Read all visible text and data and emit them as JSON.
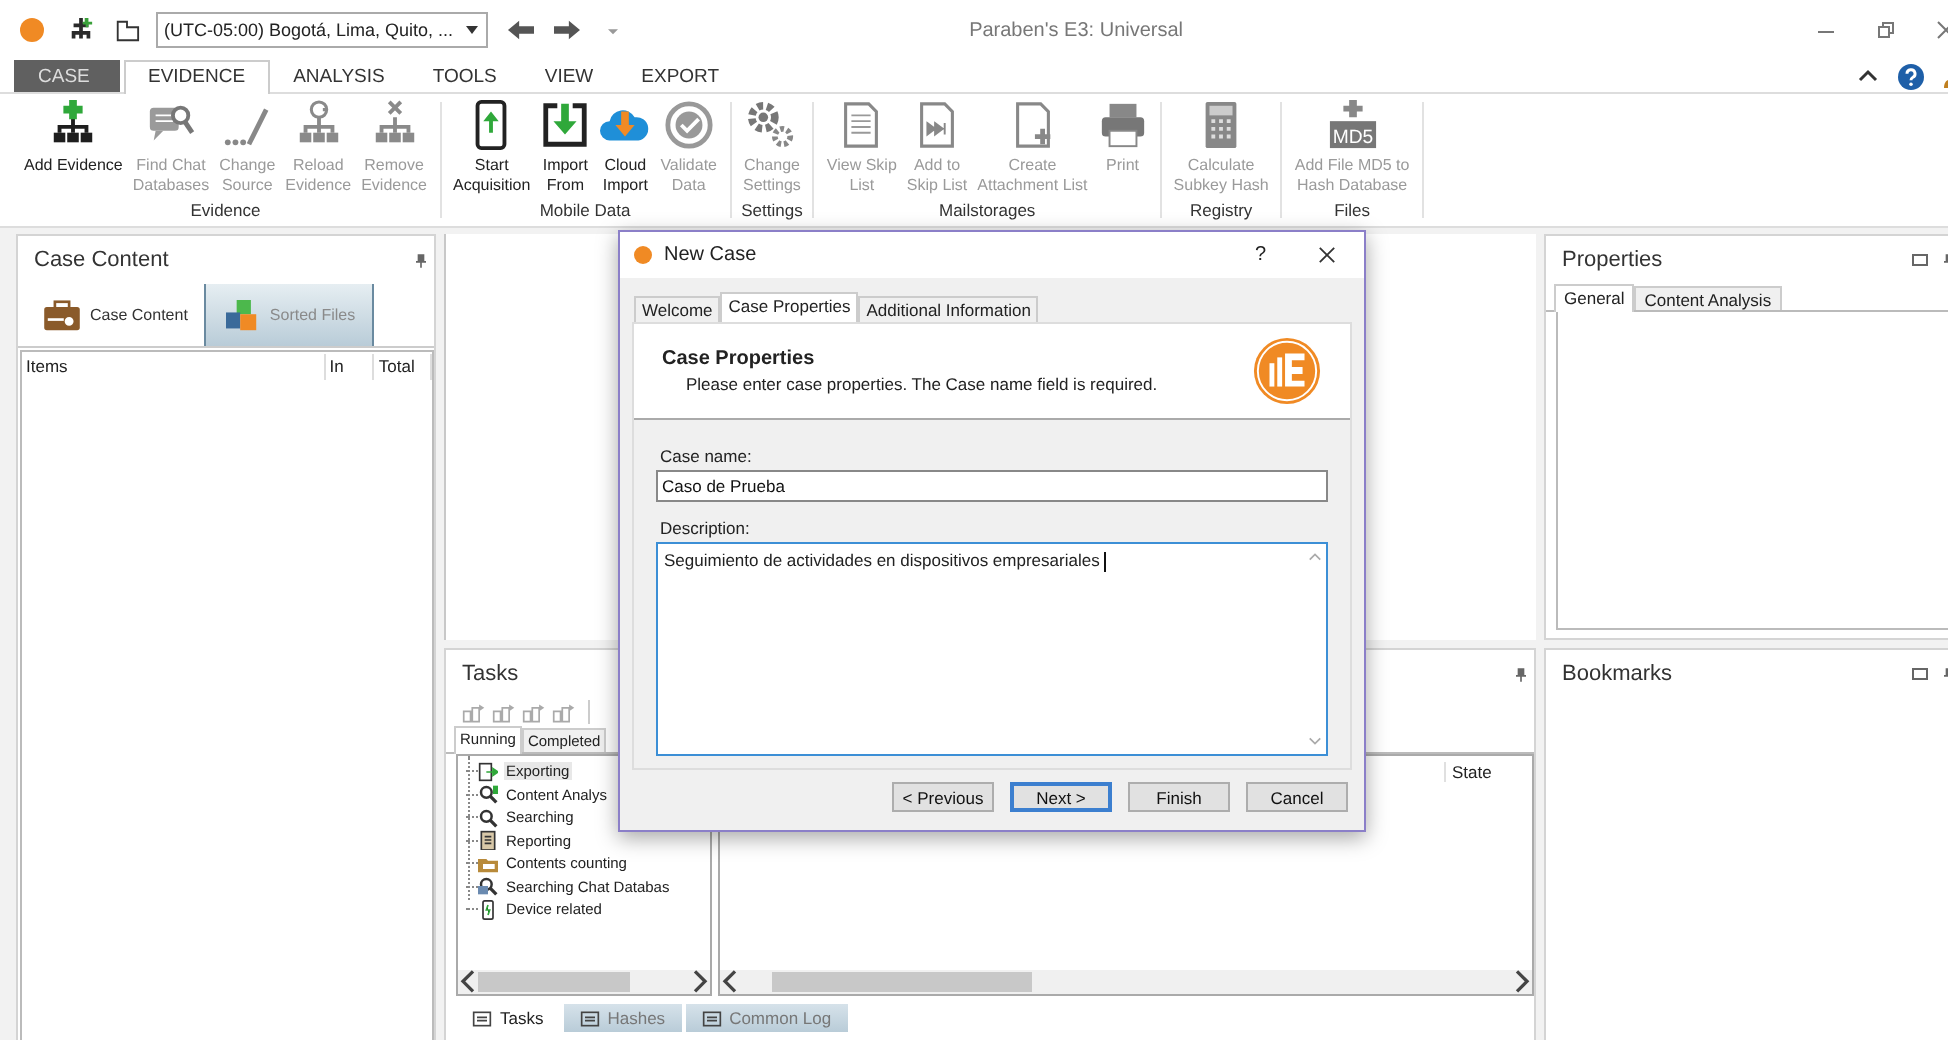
{
  "window": {
    "title": "Paraben's E3: Universal"
  },
  "quick_access": {
    "timezone": "(UTC-05:00) Bogotá, Lima, Quito, ..."
  },
  "ribbon_tabs": [
    {
      "label": "CASE",
      "kind": "menu",
      "selected": false
    },
    {
      "label": "EVIDENCE",
      "kind": "tab",
      "selected": true
    },
    {
      "label": "ANALYSIS",
      "kind": "tab",
      "selected": false
    },
    {
      "label": "TOOLS",
      "kind": "tab",
      "selected": false
    },
    {
      "label": "VIEW",
      "kind": "tab",
      "selected": false
    },
    {
      "label": "EXPORT",
      "kind": "tab",
      "selected": false
    }
  ],
  "ribbon_groups": [
    {
      "label": "Evidence",
      "buttons": [
        {
          "lines": [
            "Add Evidence"
          ],
          "disabled": false
        },
        {
          "lines": [
            "Find Chat",
            "Databases"
          ],
          "disabled": true
        },
        {
          "lines": [
            "Change",
            "Source"
          ],
          "disabled": true
        },
        {
          "lines": [
            "Reload",
            "Evidence"
          ],
          "disabled": true
        },
        {
          "lines": [
            "Remove",
            "Evidence"
          ],
          "disabled": true
        }
      ]
    },
    {
      "label": "Mobile Data",
      "buttons": [
        {
          "lines": [
            "Start",
            "Acquisition"
          ],
          "disabled": false
        },
        {
          "lines": [
            "Import",
            "From"
          ],
          "disabled": false
        },
        {
          "lines": [
            "Cloud",
            "Import"
          ],
          "disabled": false
        },
        {
          "lines": [
            "Validate",
            "Data"
          ],
          "disabled": true
        }
      ]
    },
    {
      "label": "Settings",
      "buttons": [
        {
          "lines": [
            "Change",
            "Settings"
          ],
          "disabled": true
        }
      ]
    },
    {
      "label": "Mailstorages",
      "buttons": [
        {
          "lines": [
            "View Skip",
            "List"
          ],
          "disabled": true
        },
        {
          "lines": [
            "Add to",
            "Skip List"
          ],
          "disabled": true
        },
        {
          "lines": [
            "Create",
            "Attachment List"
          ],
          "disabled": true
        },
        {
          "lines": [
            "Print"
          ],
          "disabled": true
        }
      ]
    },
    {
      "label": "Registry",
      "buttons": [
        {
          "lines": [
            "Calculate",
            "Subkey Hash"
          ],
          "disabled": true
        }
      ]
    },
    {
      "label": "Files",
      "buttons": [
        {
          "lines": [
            "Add File MD5 to",
            "Hash Database"
          ],
          "disabled": true,
          "icon_text": "MD5"
        }
      ]
    }
  ],
  "case_content": {
    "title": "Case Content",
    "tabs": [
      {
        "label": "Case Content",
        "selected": true
      },
      {
        "label": "Sorted Files",
        "selected": false
      }
    ],
    "columns": [
      "Items",
      "In",
      "Total"
    ]
  },
  "tasks": {
    "title": "Tasks",
    "tabs": [
      {
        "label": "Running",
        "selected": true
      },
      {
        "label": "Completed",
        "selected": false
      }
    ],
    "tree": [
      {
        "label": "Exporting",
        "selected": true
      },
      {
        "label": "Content Analys",
        "selected": false
      },
      {
        "label": "Searching",
        "selected": false
      },
      {
        "label": "Reporting",
        "selected": false
      },
      {
        "label": "Contents counting",
        "selected": false
      },
      {
        "label": "Searching Chat Databas",
        "selected": false
      },
      {
        "label": "Device related",
        "selected": false
      }
    ],
    "columns": [
      "State"
    ],
    "bottom_tabs": [
      {
        "label": "Tasks",
        "selected": true
      },
      {
        "label": "Hashes",
        "selected": false
      },
      {
        "label": "Common Log",
        "selected": false
      }
    ]
  },
  "properties": {
    "title": "Properties",
    "tabs": [
      {
        "label": "General",
        "selected": true
      },
      {
        "label": "Content Analysis",
        "selected": false
      }
    ]
  },
  "bookmarks": {
    "title": "Bookmarks"
  },
  "dialog": {
    "title": "New Case",
    "help": "?",
    "tabs": [
      {
        "label": "Welcome",
        "selected": false
      },
      {
        "label": "Case Properties",
        "selected": true
      },
      {
        "label": "Additional Information",
        "selected": false
      }
    ],
    "heading": "Case Properties",
    "subtitle": "Please enter case properties. The Case name field is required.",
    "fields": [
      {
        "label": "Case name:",
        "value": "Caso de Prueba",
        "kind": "line"
      },
      {
        "label": "Description:",
        "value": "Seguimiento de actividades en dispositivos empresariales ",
        "kind": "area"
      }
    ],
    "buttons": [
      {
        "label": "< Previous",
        "default": false
      },
      {
        "label": "Next >",
        "default": true
      },
      {
        "label": "Finish",
        "default": false
      },
      {
        "label": "Cancel",
        "default": false
      }
    ]
  }
}
